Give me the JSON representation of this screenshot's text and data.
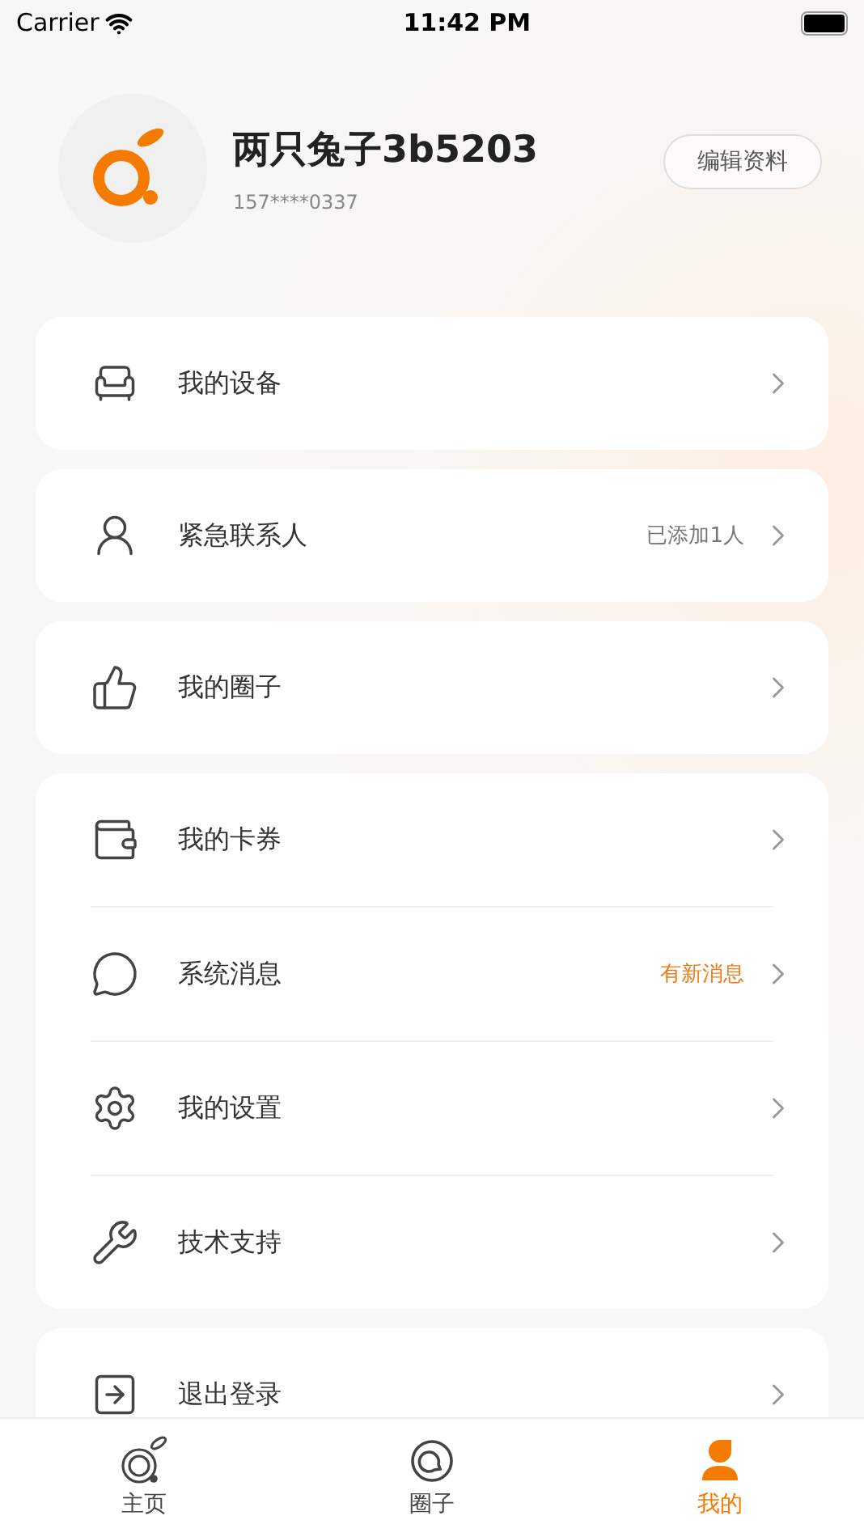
{
  "status_bar": {
    "carrier": "Carrier",
    "time": "11:42 PM"
  },
  "profile": {
    "name": "两只兔子3b5203",
    "phone": "157****0337",
    "edit_button": "编辑资料"
  },
  "cards": [
    {
      "items": [
        {
          "label": "我的设备"
        }
      ]
    },
    {
      "items": [
        {
          "label": "紧急联系人",
          "trailing": {
            "text": "已添加1人",
            "highlight": false
          }
        }
      ]
    },
    {
      "items": [
        {
          "label": "我的圈子"
        }
      ]
    },
    {
      "items": [
        {
          "label": "我的卡券"
        },
        {
          "label": "系统消息",
          "trailing": {
            "text": "有新消息",
            "highlight": true
          }
        },
        {
          "label": "我的设置"
        },
        {
          "label": "技术支持"
        }
      ]
    },
    {
      "items": [
        {
          "label": "退出登录"
        }
      ]
    }
  ],
  "tab_bar": [
    {
      "label": "主页",
      "selected": false
    },
    {
      "label": "圈子",
      "selected": false
    },
    {
      "label": "我的",
      "selected": true
    }
  ]
}
